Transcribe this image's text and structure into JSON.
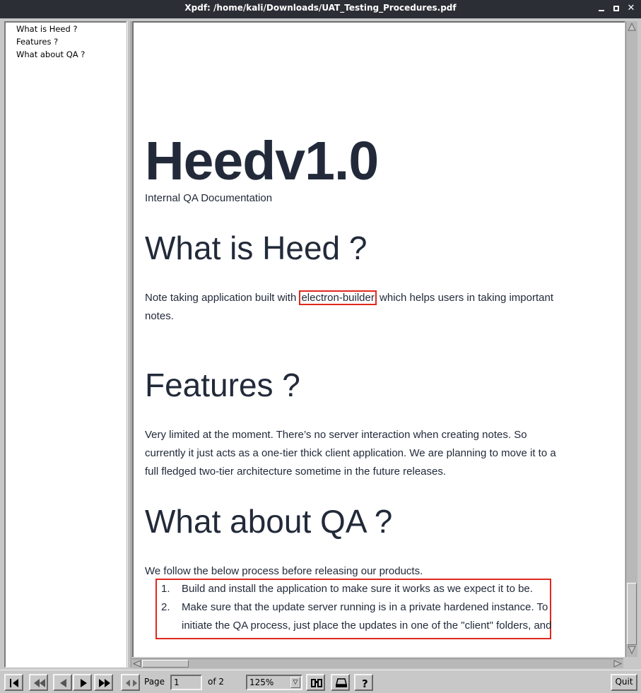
{
  "window": {
    "title": "Xpdf: /home/kali/Downloads/UAT_Testing_Procedures.pdf"
  },
  "outline": {
    "items": [
      {
        "label": "What is Heed ?"
      },
      {
        "label": "Features ?"
      },
      {
        "label": "What about QA ?"
      }
    ]
  },
  "document": {
    "logo": "Heedv1.0",
    "subtitle": "Internal QA Documentation",
    "sections": [
      {
        "heading": "What is Heed ?",
        "text_before": "Note taking application built with ",
        "highlight": "electron-builder",
        "text_after": " which helps users in taking important notes."
      },
      {
        "heading": "Features ?",
        "text": "Very limited at the moment. There’s no server interaction when creating notes. So currently it just acts as a one-tier thick client application. We are planning to move it to a full fledged two-tier architecture sometime in the future releases."
      },
      {
        "heading": "What about QA ?",
        "intro": "We follow the below process before releasing our products.",
        "list": [
          {
            "num": "1.",
            "text": "Build and install the application to make sure it works as we expect it to be."
          },
          {
            "num": "2.",
            "text": "Make sure that the update server running is in a private hardened instance. To initiate the QA process, just place the updates in one of the \"client\" folders, and"
          }
        ]
      }
    ],
    "highlight_color": "#e0281e",
    "text_color": "#222a3a"
  },
  "toolbar": {
    "page_label": "Page",
    "page_value": "1",
    "page_total": "of 2",
    "zoom": "125%",
    "quit_label": "Quit",
    "buttons": [
      {
        "icon": "first-page-icon"
      },
      {
        "icon": "back-10-pages-icon"
      },
      {
        "icon": "previous-page-icon"
      },
      {
        "icon": "next-page-icon"
      },
      {
        "icon": "forward-10-pages-icon"
      },
      {
        "icon": "back-forward-history-icon"
      },
      {
        "icon": "find-icon"
      },
      {
        "icon": "print-icon"
      },
      {
        "icon": "help-icon"
      }
    ]
  }
}
